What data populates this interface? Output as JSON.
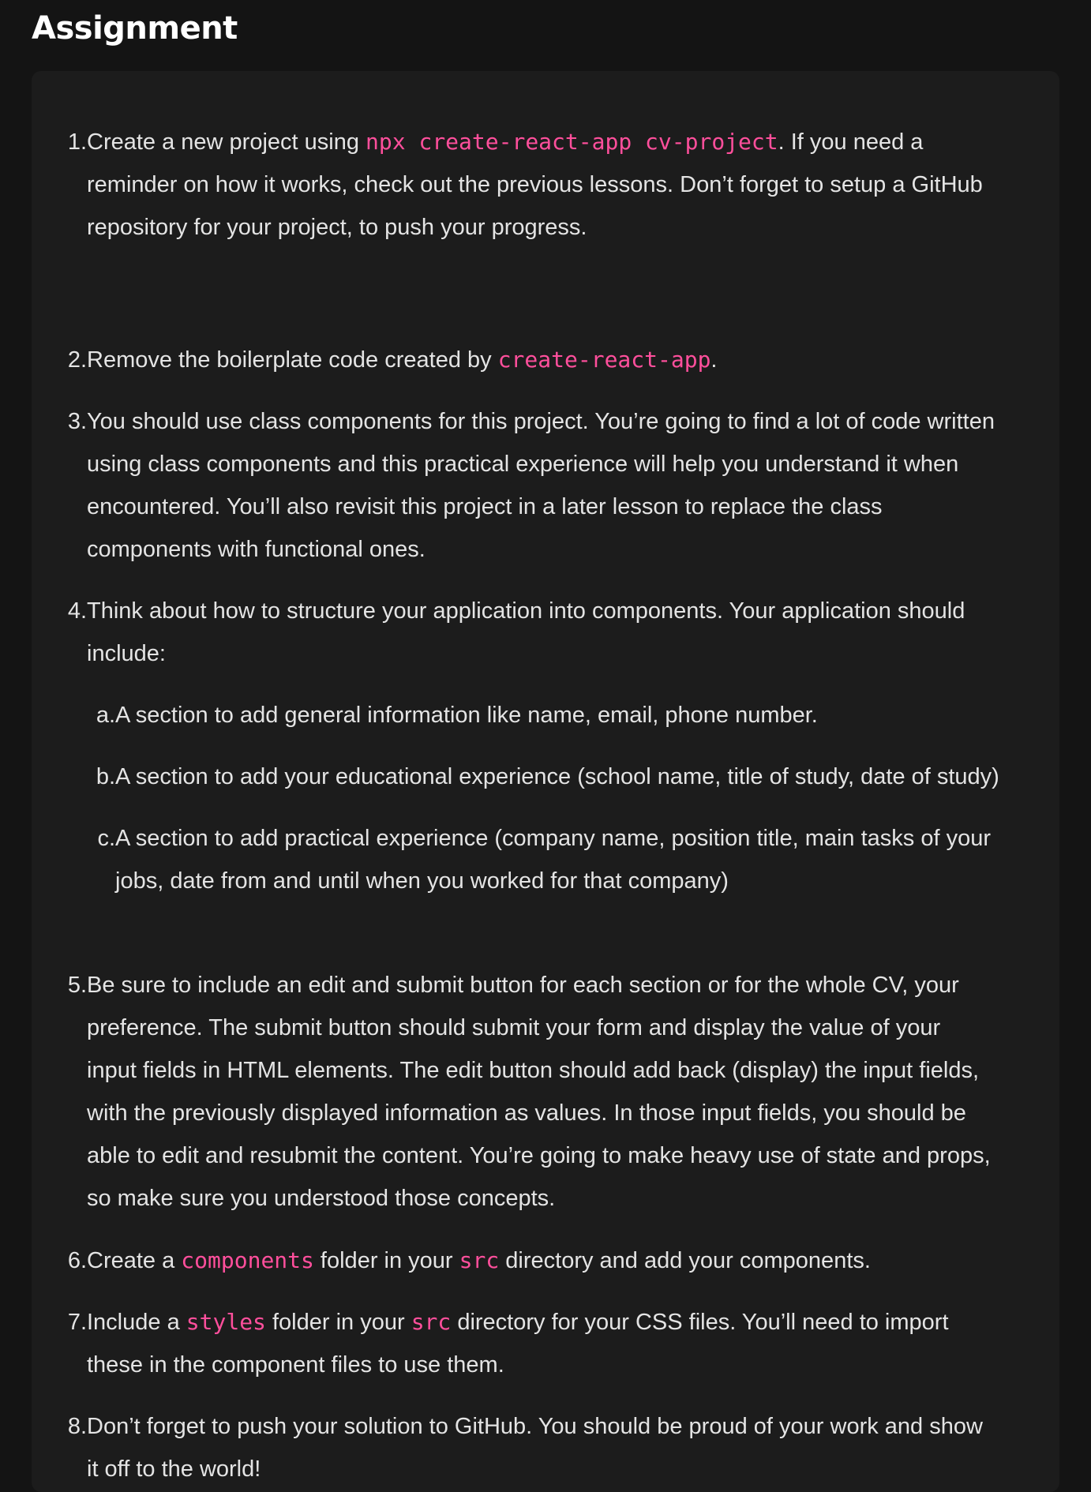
{
  "heading": "Assignment",
  "items": [
    {
      "num": "1.",
      "line1_pre": "Create a new project using ",
      "line1_code": "npx create-react-app cv-project",
      "line1_post": ". If you need a",
      "line2": "reminder on how it works, check out the previous lessons. Don’t forget to setup a GitHub",
      "line3": "repository for your project, to push your progress."
    },
    {
      "num": "2.",
      "pre": "Remove the boilerplate code created by ",
      "code": "create-react-app",
      "post": "."
    },
    {
      "num": "3.",
      "line1": "You should use class components for this project. You’re going to find a lot of code written",
      "line2": "using class components and this practical experience will help you understand it when",
      "line3": "encountered. You’ll also revisit this project in a later lesson to replace the class",
      "line4": "components with functional ones."
    },
    {
      "num": "4.",
      "line1": "Think about how to structure your application into components. Your application should",
      "line2": "include:",
      "subitems": [
        {
          "num": "a.",
          "line1": "A section to add general information like name, email, phone number."
        },
        {
          "num": "b.",
          "line1": "A section to add your educational experience (school name, title of study, date of study)"
        },
        {
          "num": "c.",
          "line1": "A section to add practical experience (company name, position title, main tasks of your",
          "line2": "jobs, date from and until when you worked for that company)"
        }
      ]
    },
    {
      "num": "5.",
      "line1": "Be sure to include an edit and submit button for each section or for the whole CV, your",
      "line2": "preference. The submit button should submit your form and display the value of your",
      "line3": "input fields in HTML elements. The edit button should add back (display) the input fields,",
      "line4": "with the previously displayed information as values. In those input fields, you should be",
      "line5": "able to edit and resubmit the content. You’re going to make heavy use of state and props,",
      "line6": "so make sure you understood those concepts."
    },
    {
      "num": "6.",
      "pre": "Create a ",
      "code1": "components",
      "mid": " folder in your ",
      "code2": "src",
      "post": " directory and add your components."
    },
    {
      "num": "7.",
      "pre": "Include a ",
      "code1": "styles",
      "mid": " folder in your ",
      "code2": "src",
      "post": " directory for your CSS files. You’ll need to import",
      "line2": "these in the component files to use them."
    },
    {
      "num": "8.",
      "line1": "Don’t forget to push your solution to GitHub. You should be proud of your work and show",
      "line2": "it off to the world!"
    }
  ]
}
